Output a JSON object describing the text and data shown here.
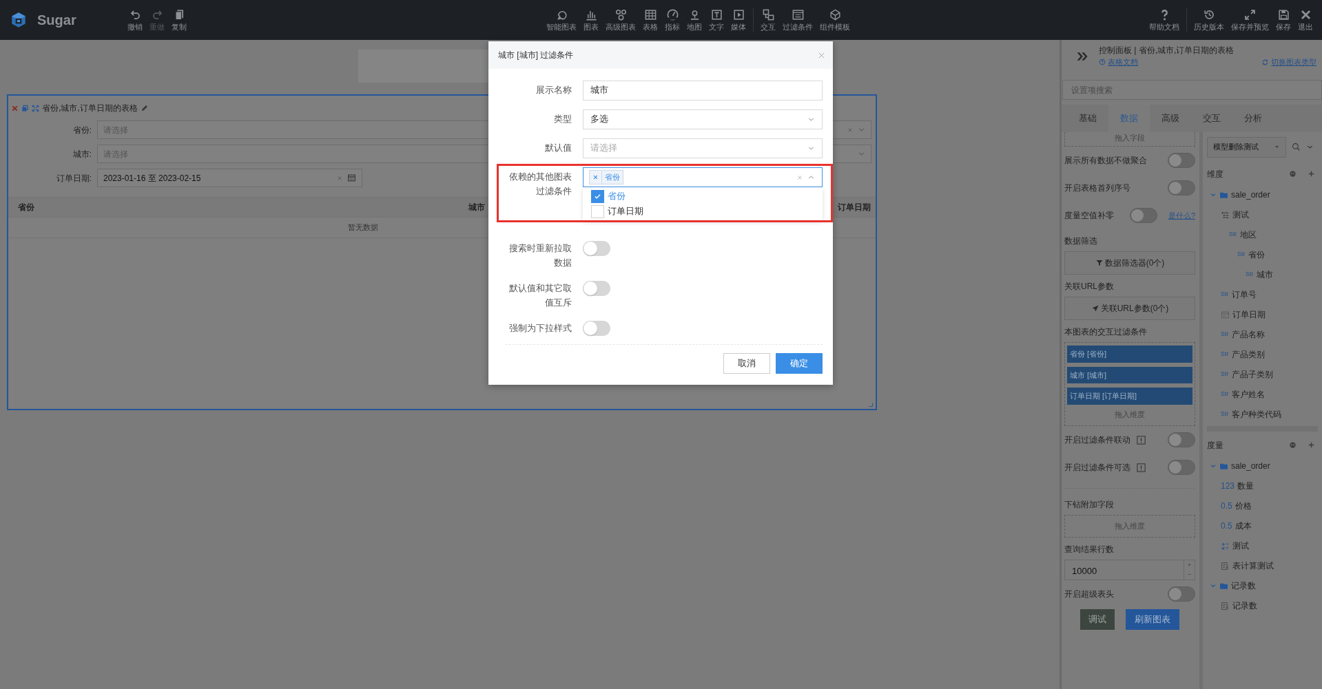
{
  "toolbar": {
    "logo": "Sugar",
    "left_actions": [
      {
        "label": "撤销",
        "disabled": false
      },
      {
        "label": "重做",
        "disabled": true
      },
      {
        "label": "复制",
        "disabled": false
      }
    ],
    "insert_groups": [
      [
        {
          "label": "智能图表"
        },
        {
          "label": "图表"
        },
        {
          "label": "高级图表"
        },
        {
          "label": "表格"
        },
        {
          "label": "指标"
        },
        {
          "label": "地图"
        },
        {
          "label": "文字"
        },
        {
          "label": "媒体"
        }
      ],
      [
        {
          "label": "交互"
        },
        {
          "label": "过滤条件"
        },
        {
          "label": "组件模板"
        }
      ]
    ],
    "right_groups": [
      [
        {
          "label": "帮助文档"
        }
      ],
      [
        {
          "label": "历史版本"
        },
        {
          "label": "保存并预览"
        },
        {
          "label": "保存"
        },
        {
          "label": "退出"
        }
      ]
    ]
  },
  "chart_card": {
    "title": "省份,城市,订单日期的表格",
    "filters": [
      {
        "label": "省份:",
        "kind": "select",
        "placeholder": "请选择",
        "clearable": true
      },
      {
        "label": "城市:",
        "kind": "select",
        "placeholder": "请选择",
        "clearable": false
      },
      {
        "label": "订单日期:",
        "kind": "daterange",
        "value": "2023-01-16 至 2023-02-15",
        "clearable": true
      }
    ],
    "table": {
      "columns": [
        "省份",
        "城市",
        "订单日期"
      ],
      "empty_text": "暂无数据"
    }
  },
  "dialog": {
    "title": "城市 [城市] 过滤条件",
    "fields": [
      {
        "label": "展示名称",
        "kind": "text",
        "value": "城市"
      },
      {
        "label": "类型",
        "kind": "select",
        "value": "多选"
      },
      {
        "label": "默认值",
        "kind": "select",
        "placeholder": "请选择"
      },
      {
        "label": "依赖的其他图表过滤条件",
        "kind": "multiselect",
        "highlighted": true,
        "expanded": true,
        "tags": [
          "省份"
        ],
        "options": [
          {
            "label": "省份",
            "checked": true
          },
          {
            "label": "订单日期",
            "checked": false
          }
        ]
      },
      {
        "label": "搜索时重新拉取数据",
        "kind": "switch",
        "on": false
      },
      {
        "label": "默认值和其它取值互斥",
        "kind": "switch",
        "on": false
      },
      {
        "label": "强制为下拉样式",
        "kind": "switch",
        "on": false
      }
    ],
    "buttons": [
      {
        "label": "取消",
        "primary": false
      },
      {
        "label": "确定",
        "primary": true
      }
    ]
  },
  "control_panel": {
    "title": "控制面板 | 省份,城市,订单日期的表格",
    "doc_link": "表格文档",
    "switch_link": "切换图表类型",
    "search": {
      "placeholder": "设置项搜索"
    },
    "tabs": [
      {
        "label": "基础",
        "selected": false
      },
      {
        "label": "数据",
        "selected": true
      },
      {
        "label": "高级",
        "selected": false
      },
      {
        "label": "交互",
        "selected": false
      },
      {
        "label": "分析",
        "selected": false
      }
    ],
    "settings": [
      {
        "kind": "dropzone",
        "label": "拖入字段"
      },
      {
        "kind": "switch",
        "label": "展示所有数据不做聚合",
        "on": false
      },
      {
        "kind": "switch",
        "label": "开启表格首列序号",
        "on": false
      },
      {
        "kind": "switch",
        "label": "度量空值补零",
        "on": false,
        "help": "是什么?"
      },
      {
        "kind": "heading",
        "label": "数据筛选"
      },
      {
        "kind": "button",
        "label": "数据筛选器(0个)"
      },
      {
        "kind": "heading",
        "label": "关联URL参数"
      },
      {
        "kind": "button",
        "label": "关联URL参数(0个)"
      },
      {
        "kind": "heading",
        "label": "本图表的交互过滤条件"
      },
      {
        "kind": "chips",
        "items": [
          "省份 [省份]",
          "城市 [城市]",
          "订单日期 [订单日期]"
        ],
        "drop_label": "拖入维度"
      },
      {
        "kind": "switch",
        "label": "开启过滤条件联动",
        "on": false,
        "info": true
      },
      {
        "kind": "switch",
        "label": "开启过滤条件可选",
        "on": false,
        "info": true
      },
      {
        "kind": "divider"
      },
      {
        "kind": "heading",
        "label": "下钻附加字段"
      },
      {
        "kind": "dropzone",
        "label": "拖入维度"
      },
      {
        "kind": "heading",
        "label": "查询结果行数"
      },
      {
        "kind": "number",
        "value": "10000"
      },
      {
        "kind": "switch",
        "label": "开启超级表头",
        "on": false
      },
      {
        "kind": "actions",
        "buttons": [
          {
            "label": "调试",
            "primary": false
          },
          {
            "label": "刷新图表",
            "primary": true
          }
        ]
      }
    ],
    "dataset": {
      "value": "模型删除测试"
    },
    "sections": [
      {
        "title": "维度",
        "tree": [
          {
            "label": "sale_order",
            "kind": "folder",
            "expanded": true,
            "children": [
              {
                "label": "测试",
                "kind": "hierarchy",
                "children": [
                  {
                    "label": "地区",
                    "kind": "field",
                    "type_label": "Str",
                    "children": [
                      {
                        "label": "省份",
                        "kind": "field",
                        "type_label": "Str",
                        "children": [
                          {
                            "label": "城市",
                            "kind": "field",
                            "type_label": "Str"
                          }
                        ]
                      }
                    ]
                  }
                ]
              },
              {
                "label": "订单号",
                "kind": "field",
                "type_label": "Str"
              },
              {
                "label": "订单日期",
                "kind": "date"
              },
              {
                "label": "产品名称",
                "kind": "field",
                "type_label": "Str"
              },
              {
                "label": "产品类别",
                "kind": "field",
                "type_label": "Str"
              },
              {
                "label": "产品子类别",
                "kind": "field",
                "type_label": "Str"
              },
              {
                "label": "客户姓名",
                "kind": "field",
                "type_label": "Str"
              },
              {
                "label": "客户种类代码",
                "kind": "field",
                "type_label": "Str"
              }
            ]
          }
        ]
      },
      {
        "title": "度量",
        "tree": [
          {
            "label": "sale_order",
            "kind": "folder",
            "expanded": true,
            "children": [
              {
                "label": "数量",
                "kind": "field",
                "type_label": "123"
              },
              {
                "label": "价格",
                "kind": "field",
                "type_label": "0.5"
              },
              {
                "label": "成本",
                "kind": "field",
                "type_label": "0.5"
              },
              {
                "label": "测试",
                "kind": "calc"
              },
              {
                "label": "表计算测试",
                "kind": "tablecalc"
              }
            ]
          },
          {
            "label": "记录数",
            "kind": "folder",
            "expanded": true,
            "children": [
              {
                "label": "记录数",
                "kind": "tablecalc"
              }
            ]
          }
        ]
      }
    ]
  }
}
